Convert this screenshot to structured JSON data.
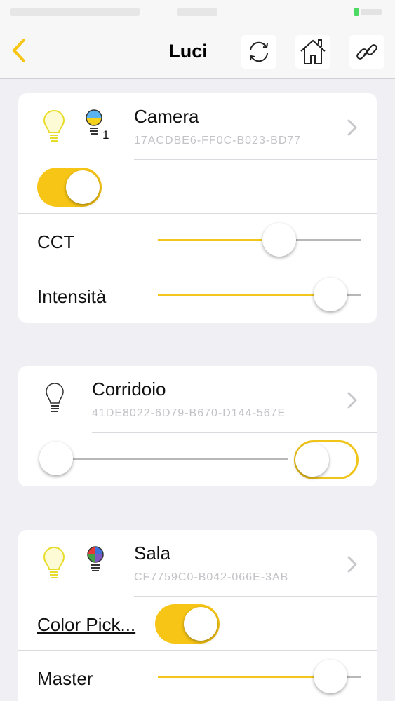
{
  "nav": {
    "title": "Luci"
  },
  "icons": {
    "back": "chevron-left-icon",
    "refresh": "refresh-icon",
    "home": "home-icon",
    "link": "link-icon"
  },
  "colors": {
    "accent": "#f7c515",
    "track": "#b8b8b8",
    "id_text": "#c2c2c7",
    "background": "#efeff4"
  },
  "devices": [
    {
      "name": "Camera",
      "id": "17ACDBE6-FF0C-B023-BD77",
      "badge": "1",
      "power_on": true,
      "sliders": [
        {
          "label": "CCT",
          "value": 0.62
        },
        {
          "label": "Intensità",
          "value": 0.92
        }
      ]
    },
    {
      "name": "Corridoio",
      "id": "41DE8022-6D79-B670-D144-567E",
      "slider_value": 0.0,
      "power_on": false
    },
    {
      "name": "Sala",
      "id": "CF7759C0-B042-066E-3AB",
      "color_picker_label": "Color Pick...",
      "color_picker_on": true,
      "sliders": [
        {
          "label": "Master",
          "value": 0.92
        }
      ]
    }
  ]
}
